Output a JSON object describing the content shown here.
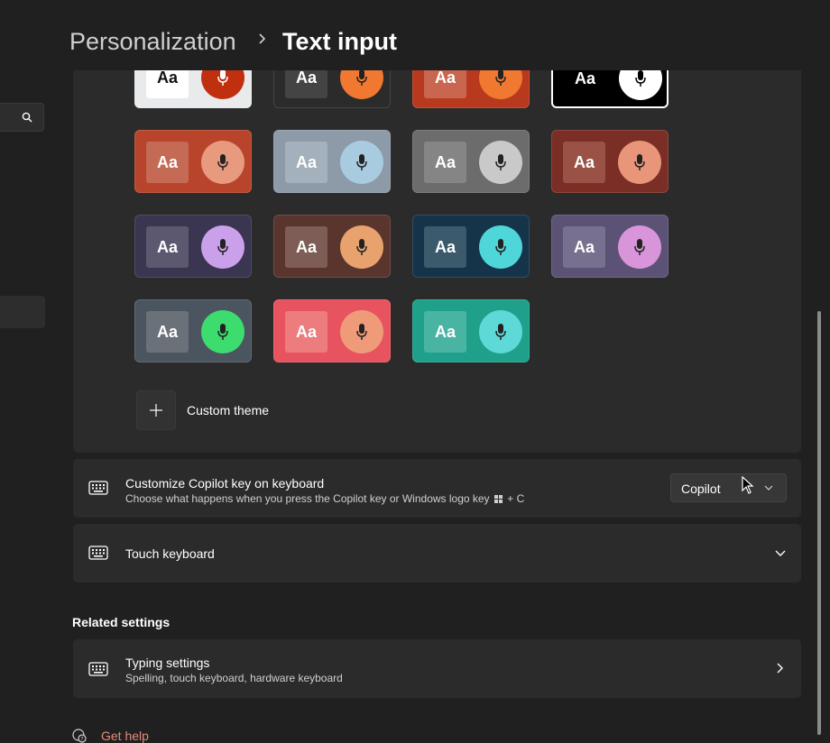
{
  "breadcrumb": {
    "parent": "Personalization",
    "current": "Text input"
  },
  "themes": {
    "tiles": [
      {
        "aa": "Aa",
        "bg": "#e9eaec",
        "aa_bg": "#ffffff",
        "aa_color": "#111111",
        "mic_bg": "#c0300f",
        "mic_color": "#ffffff"
      },
      {
        "aa": "Aa",
        "bg": "#2b2b2b",
        "aa_bg": "#444444",
        "aa_color": "#ffffff",
        "mic_bg": "#f07830",
        "mic_color": "#222222"
      },
      {
        "aa": "Aa",
        "bg": "#b9391f",
        "aa_bg": "#c8664f",
        "aa_color": "#ffffff",
        "mic_bg": "#f07830",
        "mic_color": "#222222"
      },
      {
        "aa": "Aa",
        "bg": "#000000",
        "aa_bg": "#000000",
        "aa_color": "#ffffff",
        "mic_bg": "#ffffff",
        "mic_color": "#000000"
      },
      {
        "aa": "Aa",
        "bg": "#b8452b",
        "aa_bg": "#c46a55",
        "aa_color": "#ffffff",
        "mic_bg": "#e89a7e",
        "mic_color": "#222222"
      },
      {
        "aa": "Aa",
        "bg": "#8d9aa7",
        "aa_bg": "#a4b0bb",
        "aa_color": "#ffffff",
        "mic_bg": "#a9cbe0",
        "mic_color": "#222222"
      },
      {
        "aa": "Aa",
        "bg": "#6c6c6c",
        "aa_bg": "#858585",
        "aa_color": "#ffffff",
        "mic_bg": "#c9c9c9",
        "mic_color": "#222222"
      },
      {
        "aa": "Aa",
        "bg": "#7a2e25",
        "aa_bg": "#9a5246",
        "aa_color": "#ffffff",
        "mic_bg": "#e9957a",
        "mic_color": "#222222"
      },
      {
        "aa": "Aa",
        "bg": "#3a3550",
        "aa_bg": "#5c5870",
        "aa_color": "#ffffff",
        "mic_bg": "#caa0ea",
        "mic_color": "#222222"
      },
      {
        "aa": "Aa",
        "bg": "#5a352e",
        "aa_bg": "#7d5d55",
        "aa_color": "#ffffff",
        "mic_bg": "#e8a26e",
        "mic_color": "#222222"
      },
      {
        "aa": "Aa",
        "bg": "#15344a",
        "aa_bg": "#3b5a6b",
        "aa_color": "#ffffff",
        "mic_bg": "#4fd6d8",
        "mic_color": "#222222"
      },
      {
        "aa": "Aa",
        "bg": "#5c5276",
        "aa_bg": "#77708e",
        "aa_color": "#ffffff",
        "mic_bg": "#d895d9",
        "mic_color": "#222222"
      },
      {
        "aa": "Aa",
        "bg": "#4b5560",
        "aa_bg": "#6b7178",
        "aa_color": "#ffffff",
        "mic_bg": "#3ddc6f",
        "mic_color": "#222222"
      },
      {
        "aa": "Aa",
        "bg": "#e7535e",
        "aa_bg": "#ec7c7e",
        "aa_color": "#ffffff",
        "mic_bg": "#ef9b79",
        "mic_color": "#222222"
      },
      {
        "aa": "Aa",
        "bg": "#1fa08a",
        "aa_bg": "#4ab4a3",
        "aa_color": "#ffffff",
        "mic_bg": "#5fd8d8",
        "mic_color": "#222222"
      }
    ],
    "custom_label": "Custom theme"
  },
  "copilot_row": {
    "title": "Customize Copilot key on keyboard",
    "subtitle_prefix": "Choose what happens when you press the Copilot key or Windows logo key",
    "subtitle_suffix": "+ C",
    "dropdown_value": "Copilot"
  },
  "touch_row": {
    "title": "Touch keyboard"
  },
  "related": {
    "heading": "Related settings",
    "typing_title": "Typing settings",
    "typing_subtitle": "Spelling, touch keyboard, hardware keyboard"
  },
  "help": {
    "label": "Get help"
  },
  "colors": {
    "accent_link": "#e58a7a",
    "card_bg": "#2b2b2b",
    "page_bg": "#202020"
  }
}
